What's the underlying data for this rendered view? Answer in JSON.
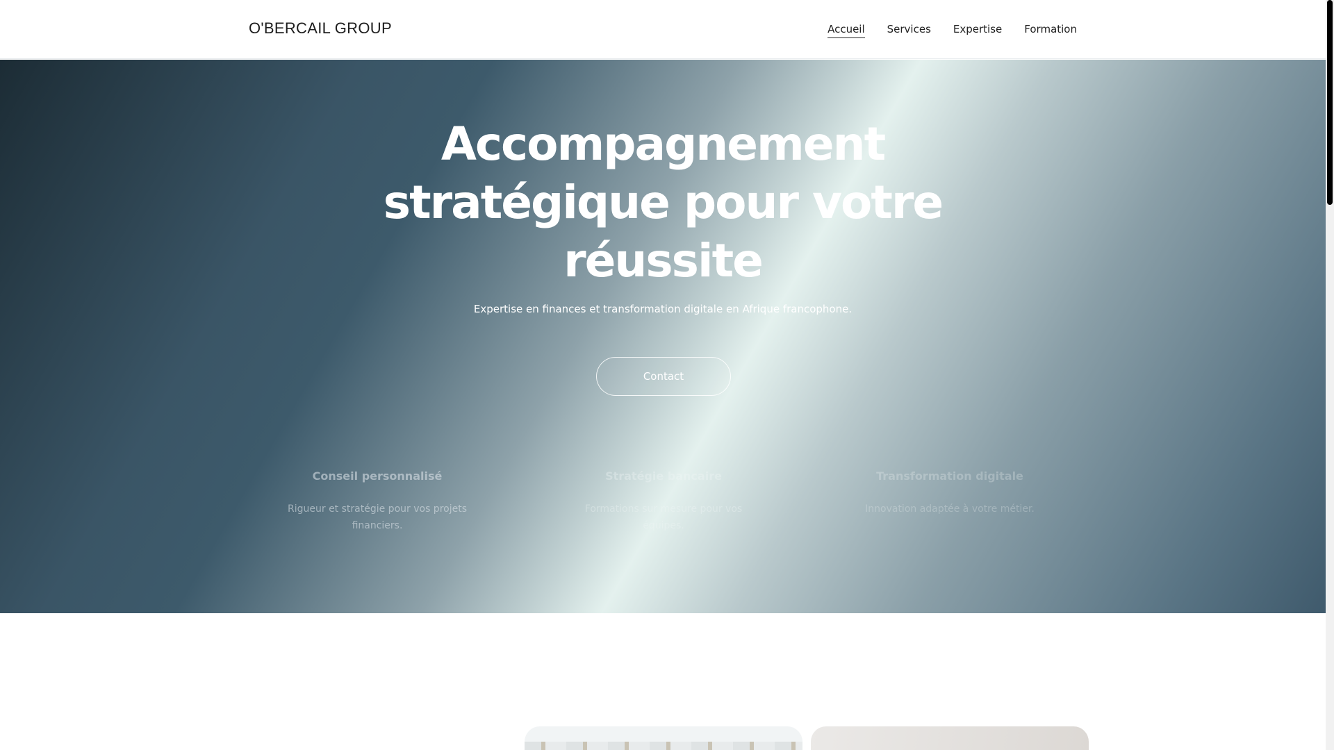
{
  "header": {
    "logo": "O'BERCAIL GROUP",
    "nav": [
      {
        "label": "Accueil",
        "active": true
      },
      {
        "label": "Services",
        "active": false
      },
      {
        "label": "Expertise",
        "active": false
      },
      {
        "label": "Formation",
        "active": false
      }
    ]
  },
  "hero": {
    "title_lines": [
      "Accompagnement",
      "stratégique pour votre",
      "réussite"
    ],
    "subtitle": "Expertise en finances et transformation digitale en Afrique francophone.",
    "cta_label": "Contact",
    "features": [
      {
        "title": "Conseil personnalisé",
        "text": "Rigueur et stratégie pour vos projets financiers."
      },
      {
        "title": "Stratégie bancaire",
        "text": "Formations sur mesure pour vos équipes."
      },
      {
        "title": "Transformation digitale",
        "text": "Innovation adaptée à votre métier."
      }
    ]
  },
  "colors": {
    "hero_dark": "#1c2c35",
    "hero_mid": "#3d5a6b",
    "hero_light": "#e4f1ee",
    "text_dark": "#1d1d1d"
  }
}
